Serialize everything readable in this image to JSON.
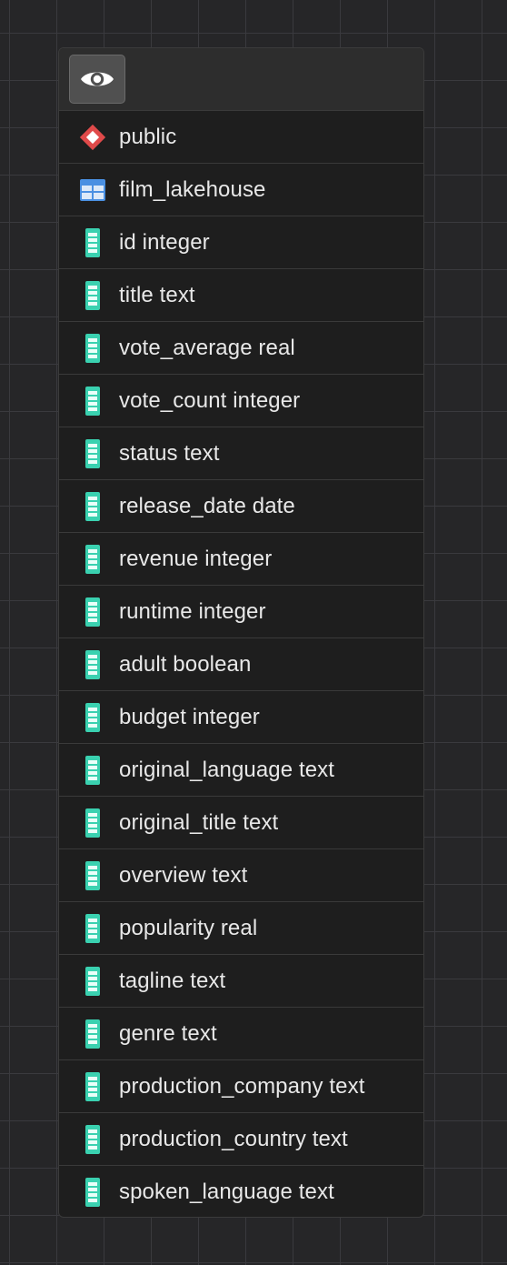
{
  "header": {
    "eye_button_icon": "eye-icon"
  },
  "schema": {
    "name": "public",
    "icon": "schema-diamond-icon",
    "color": "#e04a4a"
  },
  "table": {
    "name": "film_lakehouse",
    "icon": "table-icon",
    "color": "#4a90e2"
  },
  "column_icon_color": "#3ad1b0",
  "columns": [
    {
      "label": "id integer"
    },
    {
      "label": "title text"
    },
    {
      "label": "vote_average real"
    },
    {
      "label": "vote_count integer"
    },
    {
      "label": "status text"
    },
    {
      "label": "release_date date"
    },
    {
      "label": "revenue integer"
    },
    {
      "label": "runtime integer"
    },
    {
      "label": "adult boolean"
    },
    {
      "label": "budget integer"
    },
    {
      "label": "original_language text"
    },
    {
      "label": "original_title text"
    },
    {
      "label": "overview text"
    },
    {
      "label": "popularity real"
    },
    {
      "label": "tagline text"
    },
    {
      "label": "genre text"
    },
    {
      "label": "production_company text"
    },
    {
      "label": "production_country text"
    },
    {
      "label": "spoken_language text"
    }
  ]
}
